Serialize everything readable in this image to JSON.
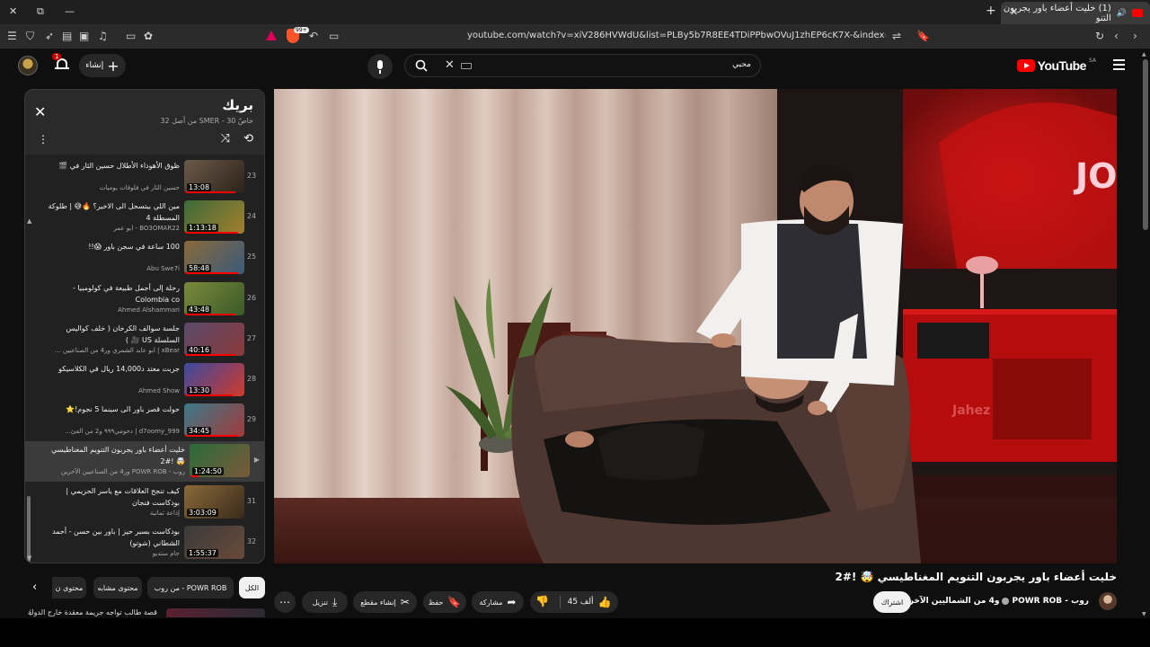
{
  "browser": {
    "tab_title": "(1) خليت أعضاء باور يجربون التنو",
    "url": "youtube.com/watch?v=xiV286HVWdU&list=PLBy5b7R8EE4TDiPPbwOVuJ1zhEP6cK7X-&index=30",
    "shield_badge": "99+"
  },
  "header": {
    "logo_text": "YouTube",
    "region": "SA",
    "search_value": "محبي",
    "create_label": "إنشاء",
    "notification_count": "1"
  },
  "playlist": {
    "title": "بريك",
    "subtitle": "خاصّ SMER - 30 من أصل 32",
    "items": [
      {
        "index": "23",
        "title": "ظوق الأهوداء الأطلال حسين الثار في 🎬",
        "channel": "حسين الثار في فلوقات يوميات",
        "duration": "13:08",
        "progress": 0.85,
        "thumb": [
          "#6b5a4a",
          "#2c2218"
        ]
      },
      {
        "index": "24",
        "title": "مين اللي بيتسحل الى الاخير؟ 🔥😅 | طلوكة المسطلة 4",
        "channel": "BO3OMAR22 - ابو عمر",
        "duration": "1:13:18",
        "progress": 0.9,
        "thumb": [
          "#3c6a3a",
          "#a3802d"
        ]
      },
      {
        "index": "25",
        "title": "100 ساعة في سجن باور 😱!!",
        "channel": "Abu Swe7i",
        "duration": "58:48",
        "progress": 0.9,
        "thumb": [
          "#8a6a3a",
          "#3a5a7a"
        ]
      },
      {
        "index": "26",
        "title": "رحلة إلى أجمل طبيعة في كولومبيا - Colombia co",
        "channel": "Ahmed Alshammari",
        "duration": "43:48",
        "progress": 0.85,
        "thumb": [
          "#7a8a3a",
          "#3a5a2a"
        ]
      },
      {
        "index": "27",
        "title": "جلسة سوالف الكرخان ( خلف كواليس السلسلة US 🎥 )",
        "channel": "xBear | ابو عابد الشمري ور4 من الصناعيين ...",
        "duration": "40:16",
        "progress": 0.85,
        "thumb": [
          "#5a4a6a",
          "#8a3a3a"
        ]
      },
      {
        "index": "28",
        "title": "جربت معتد د14,000 ريال في الكلاسيكو",
        "channel": "Ahmed Show",
        "duration": "13:30",
        "progress": 0.8,
        "thumb": [
          "#3a4aa0",
          "#d03a2a"
        ]
      },
      {
        "index": "29",
        "title": "حولت قصر باور الى سينما 5 نجوم!⭐",
        "channel": "d7oomy_999 | دحومي٩٩٩ و2 من الفئ...",
        "duration": "34:45",
        "progress": 0.9,
        "thumb": [
          "#3a7a8a",
          "#a03a3a"
        ]
      },
      {
        "index": "",
        "title": "خليت أعضاء باور يجربون التنويم المغناطيسي 🤯 !#2",
        "channel": "روب - POWR ROB ور4 من الصناعيين الآخرين",
        "duration": "1:24:50",
        "progress": 0.15,
        "thumb": [
          "#2a6a3a",
          "#7a5a3a"
        ],
        "active": true
      },
      {
        "index": "31",
        "title": "كيف تنجح العلاقات مع ياسر الحزيمي | بودكاست فنجان",
        "channel": "إذاعة ثمانية",
        "duration": "3:03:09",
        "progress": 0.0,
        "thumb": [
          "#8a6a3a",
          "#3a2a1a"
        ]
      },
      {
        "index": "32",
        "title": "بودكاست بسبر حيز | باور بين حسن - أحمد الشطاني (شوتو)",
        "channel": "جام ستديو",
        "duration": "1:55:37",
        "progress": 0.0,
        "thumb": [
          "#3a3a3a",
          "#6a4a3a"
        ]
      }
    ]
  },
  "chips": [
    "الكل",
    "من روب - POWR ROB",
    "محتوى مشابه",
    "محتوى ن"
  ],
  "upnext": {
    "title": "قصة طالب تواجه جريمة معقدة خارج الدولة ("
  },
  "video": {
    "title": "خليت أعضاء باور يجربون التنويم المغناطيسي 🤯 !#2",
    "owner": "روب - POWR ROB",
    "owner_suffix": "و4 من الشماليين الآخرين",
    "subscribe": "اشتراك",
    "likes": "45 ألف",
    "share": "مشاركة",
    "save": "حفظ",
    "clip": "إنشاء مقطع",
    "download": "تنزيل",
    "overlay_logo": "JO",
    "jahez_text": "Jahez"
  },
  "colors": {
    "accent": "#ff0000",
    "background": "#0f0f0f",
    "panel": "#212121",
    "chip": "#272727"
  }
}
